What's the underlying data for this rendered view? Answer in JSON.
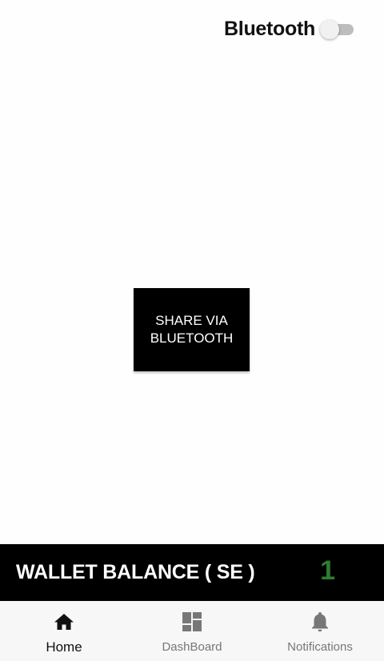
{
  "header": {
    "bluetooth_label": "Bluetooth",
    "bluetooth_enabled": false
  },
  "main": {
    "share_button_label": "SHARE VIA BLUETOOTH"
  },
  "wallet": {
    "label": "WALLET BALANCE ( SE )",
    "value": "1",
    "value_color": "#2e7d32"
  },
  "bottom_nav": {
    "items": [
      {
        "label": "Home",
        "icon": "home-icon",
        "active": true
      },
      {
        "label": "DashBoard",
        "icon": "dashboard-icon",
        "active": false
      },
      {
        "label": "Notifications",
        "icon": "bell-icon",
        "active": false
      }
    ]
  }
}
